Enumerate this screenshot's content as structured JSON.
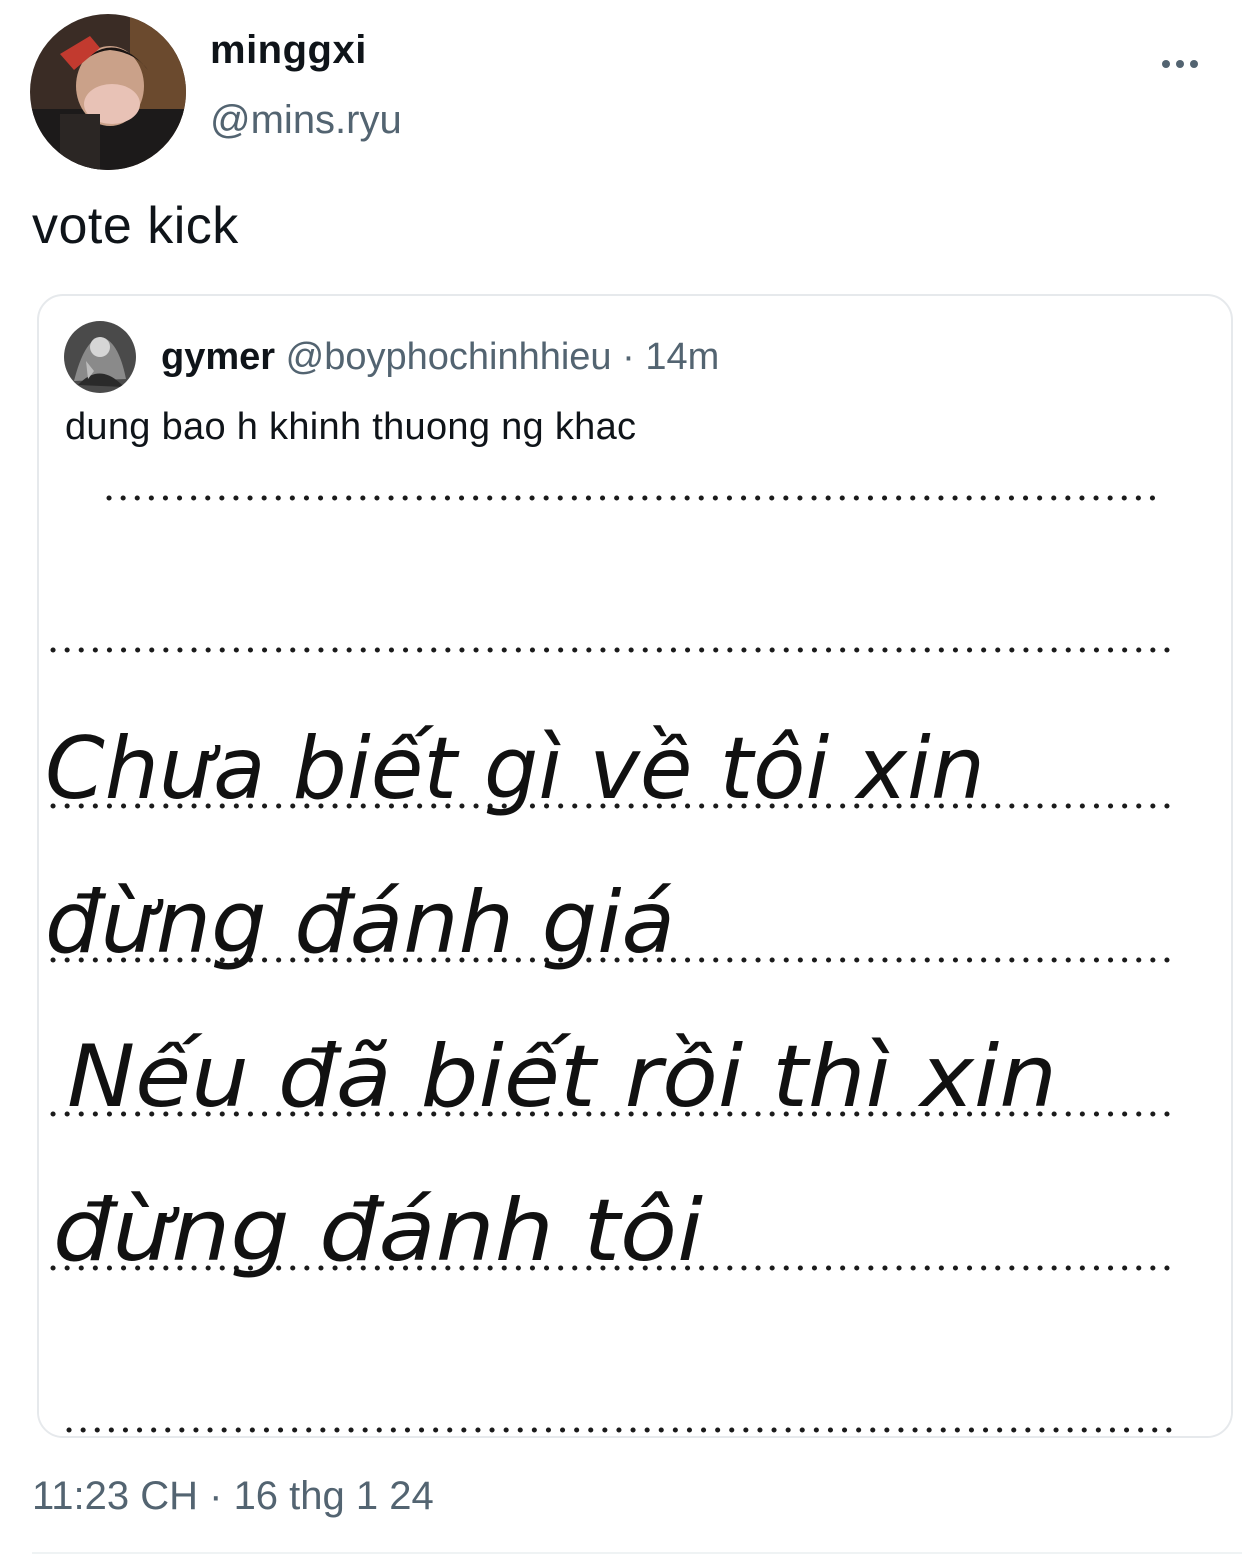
{
  "author": {
    "display_name": "minggxi",
    "handle": "@mins.ryu"
  },
  "tweet": {
    "text": "vote kick",
    "timestamp": "11:23 CH · 16 thg 1 24"
  },
  "quoted_tweet": {
    "display_name": "gymer",
    "handle": "@boyphochinhhieu",
    "separator": "·",
    "time_ago": "14m",
    "text": "dung bao h khinh thuong ng khac",
    "image_lines": [
      "Chưa biết gì về tôi xin",
      "đừng đánh giá",
      "Nếu đã biết rồi thì xin",
      "đừng đánh tôi"
    ]
  },
  "icons": {
    "more": "more-horizontal-icon"
  },
  "colors": {
    "text_primary": "#0f1419",
    "text_secondary": "#536471",
    "border": "#e6e9ec"
  }
}
